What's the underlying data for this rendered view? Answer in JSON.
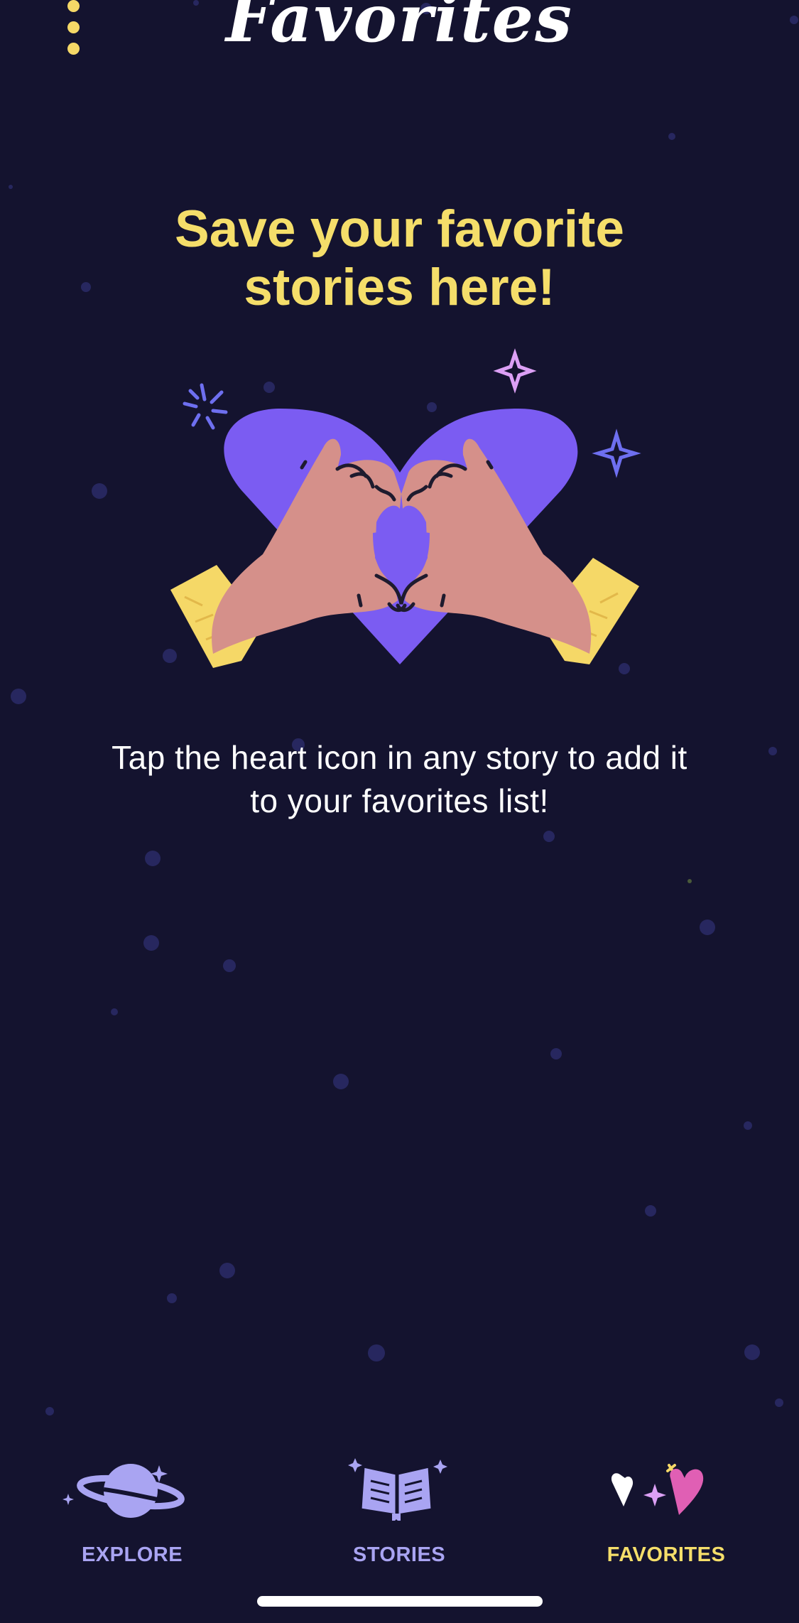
{
  "header": {
    "title": "Favorites",
    "menu_icon": "more-vertical-icon"
  },
  "empty_state": {
    "headline": "Save your favorite stories here!",
    "illustration": "heart-hands-illustration",
    "hint": "Tap the heart icon in any story to add it to your favorites list!"
  },
  "tabs": [
    {
      "label": "EXPLORE",
      "icon": "planet-icon",
      "active": false
    },
    {
      "label": "STORIES",
      "icon": "open-book-icon",
      "active": false
    },
    {
      "label": "FAVORITES",
      "icon": "hearts-icon",
      "active": true
    }
  ],
  "colors": {
    "background": "#14132f",
    "accent_yellow": "#f5de6a",
    "inactive_tab": "#a9a4f2",
    "heart_purple": "#7b5cf2",
    "star_dots": "#2a2a68"
  }
}
